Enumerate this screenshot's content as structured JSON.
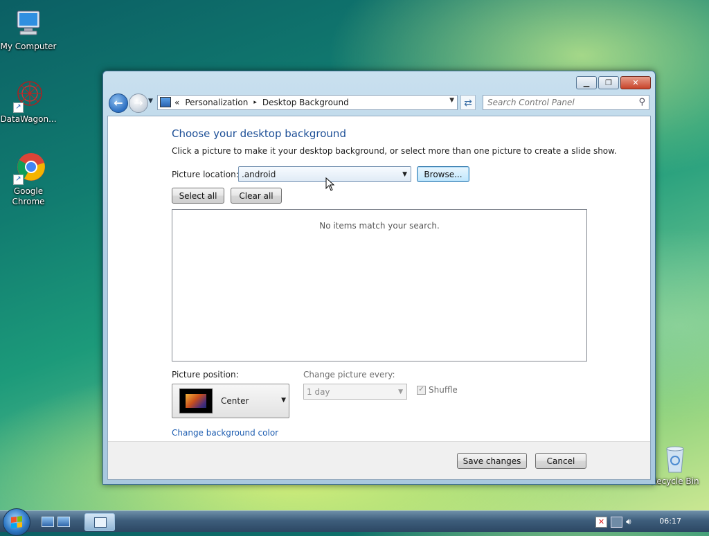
{
  "desktop": {
    "icons": [
      {
        "label": "My Computer"
      },
      {
        "label": "DataWagon..."
      },
      {
        "label": "Google Chrome"
      },
      {
        "label": "Recycle Bin"
      }
    ]
  },
  "window": {
    "breadcrumb": {
      "overflow": "«",
      "items": [
        "Personalization",
        "Desktop Background"
      ],
      "separator": "▸"
    },
    "search": {
      "placeholder": "Search Control Panel"
    },
    "title": "Choose your desktop background",
    "description": "Click a picture to make it your desktop background, or select more than one picture to create a slide show.",
    "picture_location": {
      "label": "Picture location:",
      "value": ".android"
    },
    "browse_label": "Browse...",
    "select_all_label": "Select all",
    "clear_all_label": "Clear all",
    "list_empty_text": "No items match your search.",
    "picture_position": {
      "label": "Picture position:",
      "value": "Center"
    },
    "change_every": {
      "label": "Change picture every:",
      "value": "1 day"
    },
    "shuffle": {
      "label": "Shuffle",
      "checked": true
    },
    "bg_color_link": "Change background color",
    "save_label": "Save changes",
    "cancel_label": "Cancel"
  },
  "taskbar": {
    "clock": "06:17"
  },
  "colors": {
    "accent": "#1c4e96",
    "link": "#1c5cb0",
    "close": "#c8432a"
  }
}
